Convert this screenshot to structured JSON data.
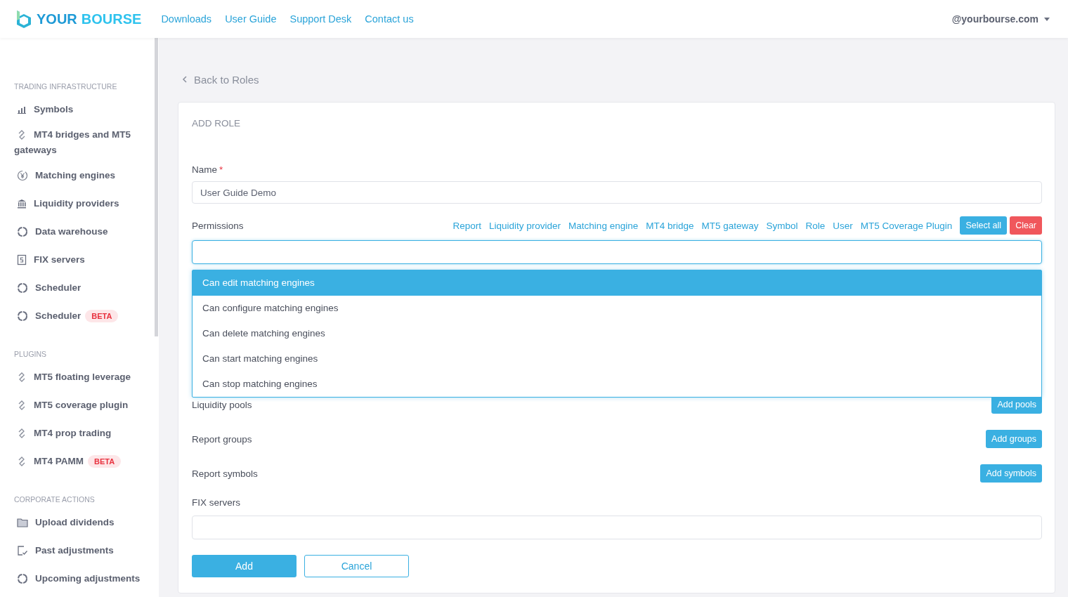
{
  "header": {
    "logo": {
      "word1": "YOUR",
      "word2": "BOURSE"
    },
    "nav": [
      "Downloads",
      "User Guide",
      "Support Desk",
      "Contact us"
    ],
    "user": "@yourbourse.com"
  },
  "sidebar": {
    "sections": [
      {
        "title": "TRADING INFRASTRUCTURE",
        "items": [
          {
            "label": "Symbols",
            "kind": "bars"
          },
          {
            "label": "MT4 bridges and MT5 gateways",
            "kind": "link"
          },
          {
            "label": "Matching engines",
            "kind": "yen"
          },
          {
            "label": "Liquidity providers",
            "kind": "bank"
          },
          {
            "label": "Data warehouse",
            "kind": "ring"
          },
          {
            "label": "FIX servers",
            "kind": "doc"
          },
          {
            "label": "Scheduler",
            "kind": "ring"
          },
          {
            "label": "Scheduler",
            "kind": "ring",
            "badge": "BETA"
          }
        ]
      },
      {
        "title": "PLUGINS",
        "items": [
          {
            "label": "MT5 floating leverage",
            "kind": "link"
          },
          {
            "label": "MT5 coverage plugin",
            "kind": "link"
          },
          {
            "label": "MT4 prop trading",
            "kind": "link"
          },
          {
            "label": "MT4 PAMM",
            "kind": "link",
            "badge": "BETA"
          }
        ]
      },
      {
        "title": "CORPORATE ACTIONS",
        "items": [
          {
            "label": "Upload dividends",
            "kind": "folder"
          },
          {
            "label": "Past adjustments",
            "kind": "check"
          },
          {
            "label": "Upcoming adjustments",
            "kind": "ring"
          }
        ]
      }
    ]
  },
  "back_link": "Back to Roles",
  "form": {
    "title": "ADD ROLE",
    "name_field": {
      "label": "Name",
      "required_mark": "*",
      "value": "User Guide Demo"
    },
    "permissions": {
      "label": "Permissions",
      "filters": [
        "Report",
        "Liquidity provider",
        "Matching engine",
        "MT4 bridge",
        "MT5 gateway",
        "Symbol",
        "Role",
        "User",
        "MT5 Coverage Plugin"
      ],
      "select_all": "Select all",
      "clear": "Clear",
      "options": [
        {
          "label": "Can edit matching engines",
          "selected": true
        },
        {
          "label": "Can configure matching engines",
          "selected": false
        },
        {
          "label": "Can delete matching engines",
          "selected": false
        },
        {
          "label": "Can start matching engines",
          "selected": false
        },
        {
          "label": "Can stop matching engines",
          "selected": false
        }
      ]
    },
    "rows": [
      {
        "label": "Liquidity pools",
        "button": "Add pools"
      },
      {
        "label": "Report groups",
        "button": "Add groups"
      },
      {
        "label": "Report symbols",
        "button": "Add symbols"
      }
    ],
    "fix_servers": {
      "label": "FIX servers"
    },
    "buttons": {
      "primary": "Add",
      "secondary": "Cancel"
    }
  }
}
